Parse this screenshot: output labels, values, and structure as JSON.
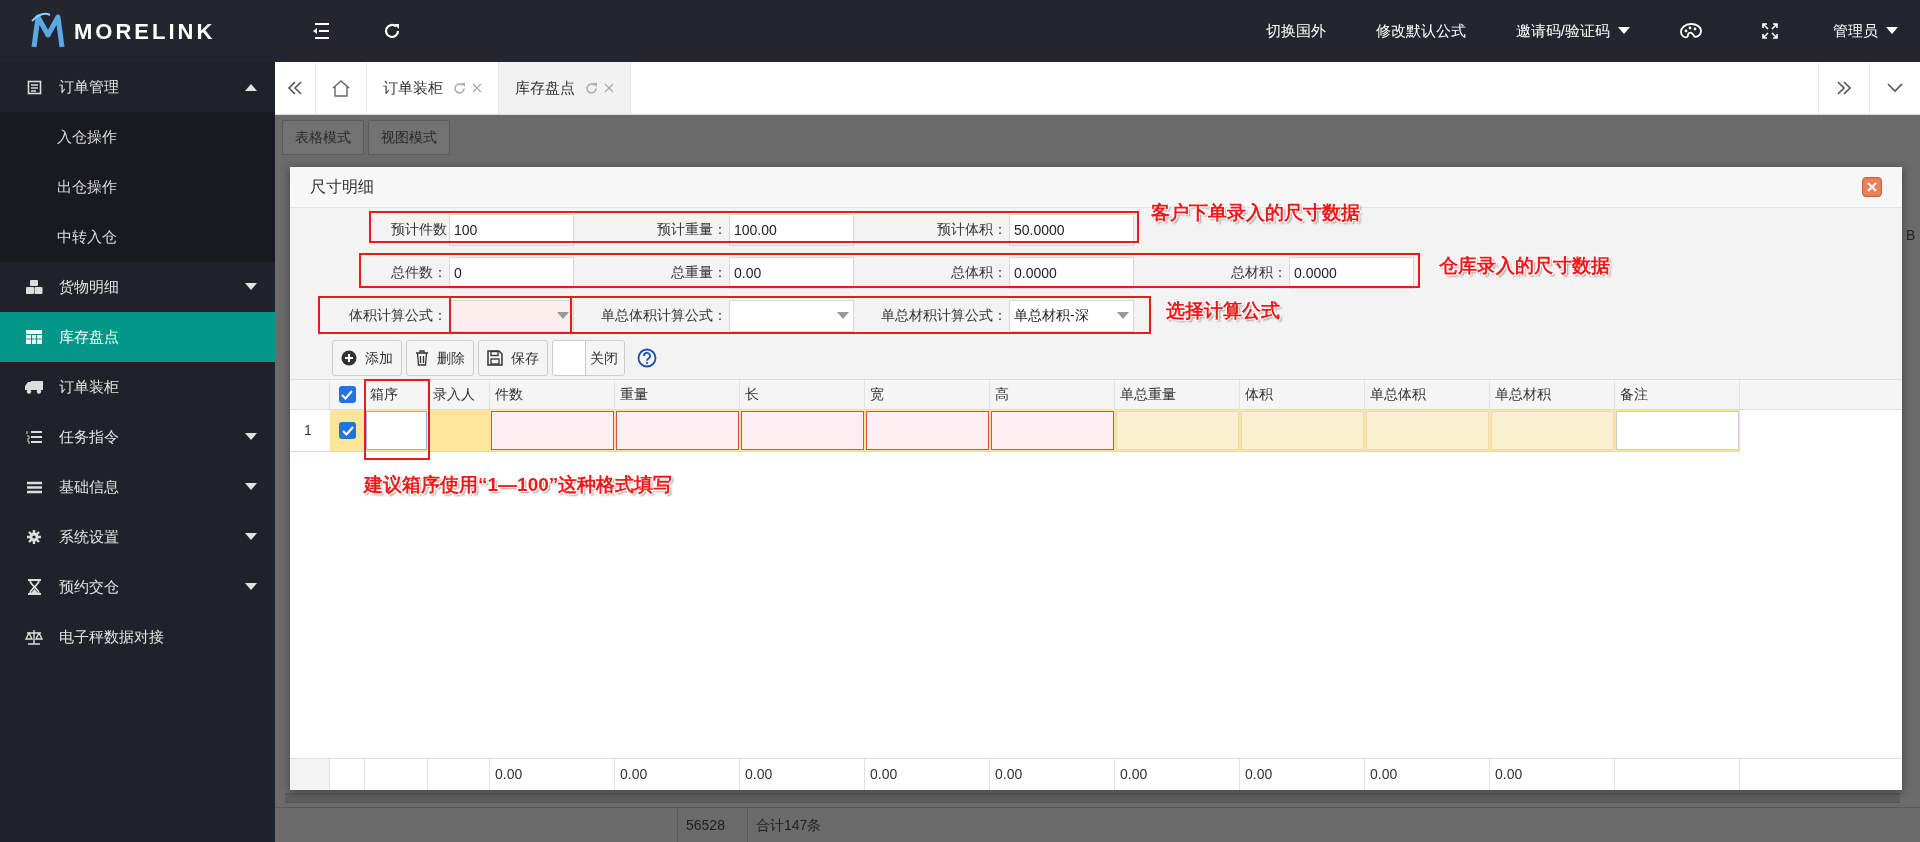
{
  "logo": {
    "text": "MORELINK"
  },
  "top_bar": {
    "links": [
      {
        "label": "切换国外",
        "dropdown": false
      },
      {
        "label": "修改默认公式",
        "dropdown": false
      },
      {
        "label": "邀请码/验证码",
        "dropdown": true
      }
    ],
    "user": {
      "label": "管理员",
      "dropdown": true
    }
  },
  "sidebar": {
    "items": [
      {
        "label": "订单管理",
        "kind": "group",
        "expanded": true,
        "selected": false,
        "children": [
          {
            "label": "入仓操作"
          },
          {
            "label": "出仓操作"
          },
          {
            "label": "中转入仓"
          }
        ]
      },
      {
        "label": "货物明细",
        "kind": "group",
        "expanded": false,
        "selected": false
      },
      {
        "label": "库存盘点",
        "kind": "link",
        "selected": true
      },
      {
        "label": "订单装柜",
        "kind": "link",
        "selected": false
      },
      {
        "label": "任务指令",
        "kind": "group",
        "expanded": false,
        "selected": false
      },
      {
        "label": "基础信息",
        "kind": "group",
        "expanded": false,
        "selected": false
      },
      {
        "label": "系统设置",
        "kind": "group",
        "expanded": false,
        "selected": false
      },
      {
        "label": "预约交仓",
        "kind": "group",
        "expanded": false,
        "selected": false
      },
      {
        "label": "电子秤数据对接",
        "kind": "link",
        "selected": false
      }
    ]
  },
  "tabs": [
    {
      "label": "订单装柜",
      "selected": false
    },
    {
      "label": "库存盘点",
      "selected": true
    }
  ],
  "view_modes": [
    {
      "label": "表格模式"
    },
    {
      "label": "视图模式"
    }
  ],
  "background": {
    "partial_heading": "B",
    "footer_cells": [
      "56528",
      "合计147条"
    ]
  },
  "dialog": {
    "title": "尺寸明细",
    "form_rows": [
      [
        {
          "label": "预计件数",
          "kind": "text",
          "value": "100"
        },
        {
          "label": "预计重量：",
          "kind": "text",
          "value": "100.00"
        },
        {
          "label": "预计体积：",
          "kind": "text",
          "value": "50.0000"
        }
      ],
      [
        {
          "label": "总件数：",
          "kind": "text",
          "value": "0"
        },
        {
          "label": "总重量：",
          "kind": "text",
          "value": "0.00"
        },
        {
          "label": "总体积：",
          "kind": "text",
          "value": "0.0000"
        },
        {
          "label": "总材积：",
          "kind": "text",
          "value": "0.0000"
        }
      ],
      [
        {
          "label": "体积计算公式：",
          "kind": "select",
          "invalid": true
        },
        {
          "label": "单总体积计算公式：",
          "kind": "select",
          "invalid": false
        },
        {
          "label": "单总材积计算公式：",
          "kind": "select",
          "invalid": false,
          "value": "单总材积-深"
        }
      ]
    ],
    "toolbar": [
      {
        "label": "添加",
        "kind": "add"
      },
      {
        "label": "删除",
        "kind": "delete"
      },
      {
        "label": "保存",
        "kind": "save"
      },
      {
        "label": "关闭",
        "kind": "close"
      }
    ],
    "table": {
      "header_checked": true,
      "columns": [
        {
          "label": "箱序",
          "kind": "focused"
        },
        {
          "label": "录入人",
          "kind": "readonly"
        },
        {
          "label": "件数",
          "kind": "required",
          "total": "0.00"
        },
        {
          "label": "重量",
          "kind": "required",
          "total": "0.00"
        },
        {
          "label": "长",
          "kind": "required",
          "total": "0.00"
        },
        {
          "label": "宽",
          "kind": "required",
          "total": "0.00"
        },
        {
          "label": "高",
          "kind": "required",
          "total": "0.00"
        },
        {
          "label": "单总重量",
          "kind": "computed",
          "total": "0.00"
        },
        {
          "label": "体积",
          "kind": "computed",
          "total": "0.00"
        },
        {
          "label": "单总体积",
          "kind": "computed",
          "total": "0.00"
        },
        {
          "label": "单总材积",
          "kind": "computed",
          "total": "0.00"
        },
        {
          "label": "备注",
          "kind": "input"
        }
      ],
      "rows": [
        {
          "number": "1",
          "checked": true
        }
      ]
    }
  },
  "annotations": [
    {
      "text": "客户下单录入的尺寸数据"
    },
    {
      "text": "仓库录入的尺寸数据"
    },
    {
      "text": "选择计算公式"
    },
    {
      "text": "建议箱序使用“1—100”这种格式填写"
    }
  ]
}
